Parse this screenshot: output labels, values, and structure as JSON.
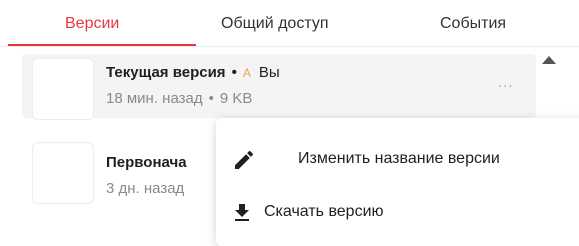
{
  "tabs": [
    {
      "label": "Версии",
      "active": true
    },
    {
      "label": "Общий доступ",
      "active": false
    },
    {
      "label": "События",
      "active": false
    }
  ],
  "versions": [
    {
      "title": "Текущая версия",
      "title_separator": "•",
      "author_initial": "A",
      "author_name": "Вы",
      "time": "18 мин. назад",
      "meta_separator": "•",
      "size": "9 KB",
      "more_label": "..."
    },
    {
      "title": "Первонача",
      "time": "3 дн. назад"
    }
  ],
  "menu": {
    "rename_label": "Изменить название версии",
    "rename_icon": "pencil-icon",
    "download_label": "Скачать версию",
    "download_icon": "download-icon"
  },
  "colors": {
    "accent": "#e8383f",
    "author_initial": "#f0a052",
    "selected_row_bg": "#f4f4f4",
    "muted_text": "#8a8a8a"
  }
}
